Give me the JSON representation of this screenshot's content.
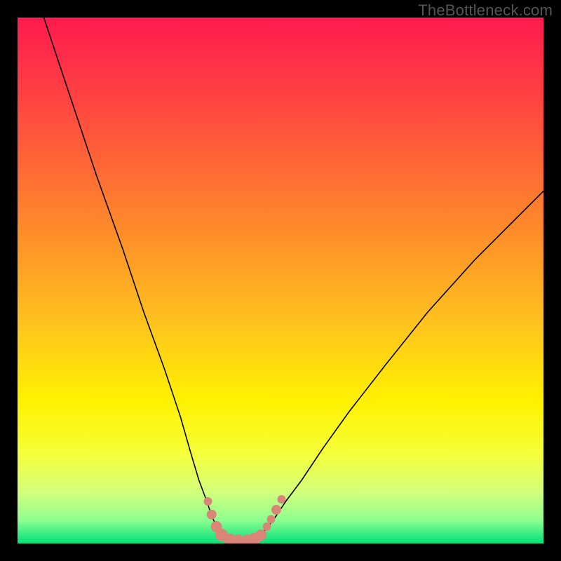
{
  "watermark": "TheBottleneck.com",
  "chart_data": {
    "type": "line",
    "title": "",
    "xlabel": "",
    "ylabel": "",
    "xlim": [
      0,
      100
    ],
    "ylim": [
      0,
      100
    ],
    "grid": false,
    "legend": false,
    "background_gradient_stops": [
      {
        "pos": 0.0,
        "color": "#ff1a4f"
      },
      {
        "pos": 0.18,
        "color": "#ff4a3f"
      },
      {
        "pos": 0.4,
        "color": "#ff8a2a"
      },
      {
        "pos": 0.58,
        "color": "#ffc21e"
      },
      {
        "pos": 0.73,
        "color": "#fff200"
      },
      {
        "pos": 0.83,
        "color": "#f5ff3a"
      },
      {
        "pos": 0.9,
        "color": "#d4ff7a"
      },
      {
        "pos": 0.955,
        "color": "#90ff90"
      },
      {
        "pos": 1.0,
        "color": "#00e07a"
      }
    ],
    "series": [
      {
        "name": "curve-left",
        "stroke": "#000000",
        "stroke_width": 1.6,
        "x": [
          5,
          10,
          15,
          20,
          24,
          28,
          31,
          33,
          34.5,
          36,
          37,
          38,
          39,
          40
        ],
        "y": [
          100,
          85,
          70,
          56,
          44,
          33,
          24,
          17,
          12,
          8,
          5,
          3,
          1.5,
          0.5
        ]
      },
      {
        "name": "curve-right",
        "stroke": "#000000",
        "stroke_width": 1.6,
        "x": [
          45,
          46,
          47.5,
          49,
          51,
          54,
          58,
          63,
          70,
          78,
          87,
          96,
          100
        ],
        "y": [
          0.5,
          1.5,
          3,
          5,
          8,
          12,
          18,
          25,
          34,
          44,
          54,
          63,
          67
        ]
      }
    ],
    "markers": {
      "name": "bottleneck-band",
      "color": "#d98578",
      "radius_small": 6,
      "radius_large": 9,
      "points": [
        {
          "x": 36.2,
          "y": 8.0,
          "r": 6
        },
        {
          "x": 36.9,
          "y": 5.5,
          "r": 7
        },
        {
          "x": 37.8,
          "y": 3.2,
          "r": 8
        },
        {
          "x": 38.8,
          "y": 1.6,
          "r": 9
        },
        {
          "x": 40.3,
          "y": 0.7,
          "r": 9
        },
        {
          "x": 42.0,
          "y": 0.5,
          "r": 9
        },
        {
          "x": 43.7,
          "y": 0.5,
          "r": 9
        },
        {
          "x": 45.0,
          "y": 0.8,
          "r": 9
        },
        {
          "x": 46.3,
          "y": 1.6,
          "r": 8
        },
        {
          "x": 47.4,
          "y": 3.2,
          "r": 6
        },
        {
          "x": 48.2,
          "y": 4.6,
          "r": 6
        },
        {
          "x": 49.2,
          "y": 6.4,
          "r": 7
        },
        {
          "x": 50.2,
          "y": 8.4,
          "r": 6
        }
      ]
    }
  }
}
